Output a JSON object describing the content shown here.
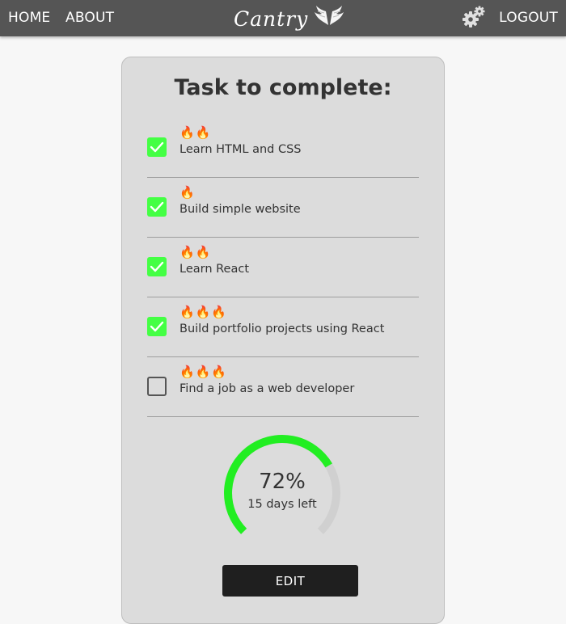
{
  "header": {
    "nav": {
      "home": "HOME",
      "about": "ABOUT",
      "logout": "LOGOUT"
    },
    "brand": "Cantry",
    "icons": {
      "settings": "gear-icon",
      "logo": "wings-icon"
    }
  },
  "card": {
    "title": "Task to complete:",
    "tasks": [
      {
        "label": "Learn HTML and CSS",
        "flames": "🔥🔥",
        "done": true
      },
      {
        "label": "Build simple website",
        "flames": "🔥",
        "done": true
      },
      {
        "label": "Learn React",
        "flames": "🔥🔥",
        "done": true
      },
      {
        "label": "Build portfolio projects using React",
        "flames": "🔥🔥🔥",
        "done": true
      },
      {
        "label": "Find a job as a web developer",
        "flames": "🔥🔥🔥",
        "done": false
      }
    ],
    "progress": {
      "percent_label": "72%",
      "percent": 72,
      "days_left": "15 days left"
    },
    "edit_label": "EDIT"
  },
  "colors": {
    "header": "#555555",
    "accent_green": "#44ff44",
    "progress_green": "#22ee22",
    "track": "#d0d0d0",
    "card": "#dcdcdc",
    "button": "#1f1f1f"
  }
}
